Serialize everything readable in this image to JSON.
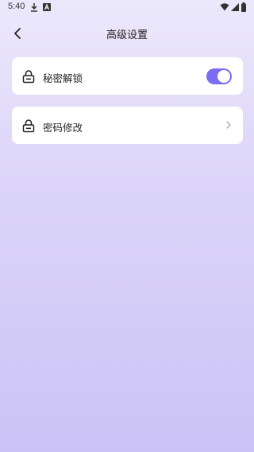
{
  "status_bar": {
    "time": "5:40",
    "icons": [
      "download-icon",
      "a-box-icon",
      "wifi-icon",
      "signal-icon",
      "battery-icon"
    ]
  },
  "header": {
    "title": "高级设置",
    "back_icon": "chevron-left-icon"
  },
  "settings": [
    {
      "label": "秘密解锁",
      "icon": "lock-icon",
      "control": "toggle",
      "enabled": true
    },
    {
      "label": "密码修改",
      "icon": "lock-icon",
      "control": "chevron"
    }
  ],
  "colors": {
    "accent": "#7b6cf1",
    "background_top": "#ece8fb",
    "background_bottom": "#cbc3f6",
    "card": "#ffffff"
  }
}
